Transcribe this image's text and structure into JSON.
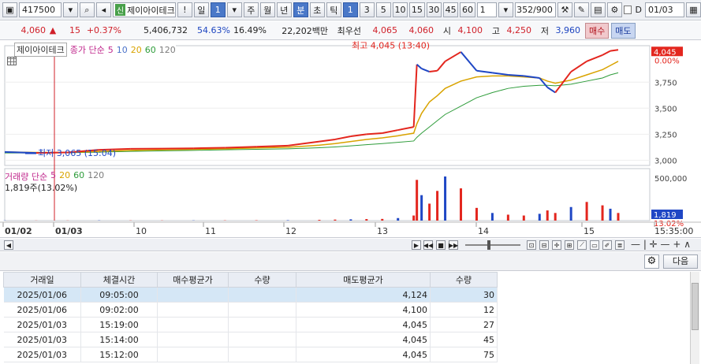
{
  "toolbar": {
    "code": "417500",
    "name_tag": "신",
    "name": "제이아이테크",
    "warn": "!",
    "period_day": "일",
    "period_num": "1",
    "periods": [
      "주",
      "월",
      "년"
    ],
    "minute": "분",
    "sec": "초",
    "tick": "틱",
    "intervals": [
      "1",
      "3",
      "5",
      "10",
      "15",
      "30",
      "45",
      "60"
    ],
    "count_value": "1",
    "bars": "352/900",
    "date_value": "01/03"
  },
  "quote": {
    "price": "4,060",
    "arrow": "▲",
    "change": "15",
    "rate": "+0.37%",
    "volume": "5,406,732",
    "vol_ratio": "54.63%",
    "turnover": "16.49%",
    "amount": "22,202백만",
    "best_label": "최우선",
    "ask": "4,065",
    "bid": "4,060",
    "open_label": "시",
    "open": "4,100",
    "high_label": "고",
    "high": "4,250",
    "low_label": "저",
    "low": "3,960",
    "buy_label": "매수",
    "sell_label": "매도"
  },
  "chart_legend": {
    "name": "제이아이테크",
    "series_label": "종가 단순",
    "ma": [
      "5",
      "10",
      "20",
      "60",
      "120"
    ],
    "high_note": "최고 4,045 (13:40)",
    "low_note": "최저 3,065 (15:04)",
    "vol_label": "거래량 단순",
    "vol_ma": [
      "5",
      "20",
      "60",
      "120"
    ],
    "vol_value": "1,819주(13.02%)"
  },
  "colors": {
    "up": "#e3261e",
    "down": "#1f47c5",
    "ma5": "#c0288d",
    "ma10": "#4a72c9",
    "ma20": "#d9a300",
    "ma60": "#2e9c3a",
    "ma120": "#7d7d7d"
  },
  "chart_data": {
    "type": "line",
    "price_axis": [
      "4,045",
      "0.00%",
      "3,750",
      "3,500",
      "3,250",
      "3,000"
    ],
    "volume_axis": [
      "500,000",
      "1,819",
      "13.02%"
    ],
    "time_axis": [
      "01/02",
      "01/03",
      "10",
      "11",
      "12",
      "13",
      "14",
      "15",
      "15:35:00"
    ],
    "ylim": [
      2950,
      4100
    ],
    "x": [
      0,
      20,
      40,
      60,
      80,
      100,
      120,
      140,
      160,
      180,
      200,
      210,
      220,
      230,
      240,
      250,
      260,
      262,
      265,
      270,
      275,
      280,
      290,
      300,
      310,
      320,
      330,
      340,
      345,
      350,
      360,
      370,
      380,
      385,
      390
    ],
    "close": [
      3080,
      3070,
      3075,
      3100,
      3110,
      3112,
      3115,
      3120,
      3130,
      3140,
      3180,
      3200,
      3230,
      3250,
      3260,
      3290,
      3320,
      3920,
      3880,
      3850,
      3860,
      3950,
      4040,
      3860,
      3840,
      3820,
      3810,
      3790,
      3700,
      3650,
      3850,
      3950,
      4010,
      4050,
      4060
    ],
    "ma20": [
      3080,
      3075,
      3075,
      3085,
      3095,
      3100,
      3105,
      3110,
      3118,
      3125,
      3145,
      3160,
      3180,
      3200,
      3215,
      3235,
      3260,
      3350,
      3450,
      3560,
      3620,
      3690,
      3760,
      3800,
      3810,
      3810,
      3800,
      3790,
      3760,
      3740,
      3770,
      3820,
      3870,
      3910,
      3950
    ],
    "ma60": [
      3070,
      3070,
      3072,
      3078,
      3085,
      3090,
      3095,
      3100,
      3105,
      3110,
      3120,
      3128,
      3138,
      3150,
      3160,
      3172,
      3185,
      3220,
      3260,
      3320,
      3380,
      3440,
      3520,
      3600,
      3650,
      3690,
      3710,
      3720,
      3720,
      3715,
      3730,
      3760,
      3790,
      3820,
      3840
    ],
    "volume": [
      2000,
      1500,
      1800,
      3000,
      2500,
      2200,
      2600,
      3000,
      4000,
      5000,
      9000,
      12000,
      15000,
      18000,
      20000,
      30000,
      60000,
      480000,
      300000,
      200000,
      350000,
      520000,
      380000,
      150000,
      90000,
      70000,
      60000,
      80000,
      120000,
      90000,
      160000,
      220000,
      180000,
      140000,
      90000
    ]
  },
  "grid": {
    "headers": [
      "거래일",
      "체결시간",
      "매수평균가",
      "수량",
      "매도평균가",
      "수량"
    ],
    "rows": [
      [
        "2025/01/06",
        "09:05:00",
        "",
        "",
        "4,124",
        "30"
      ],
      [
        "2025/01/06",
        "09:02:00",
        "",
        "",
        "4,100",
        "12"
      ],
      [
        "2025/01/03",
        "15:19:00",
        "",
        "",
        "4,045",
        "27"
      ],
      [
        "2025/01/03",
        "15:14:00",
        "",
        "",
        "4,045",
        "45"
      ],
      [
        "2025/01/03",
        "15:12:00",
        "",
        "",
        "4,045",
        "75"
      ]
    ],
    "next_label": "다음"
  }
}
